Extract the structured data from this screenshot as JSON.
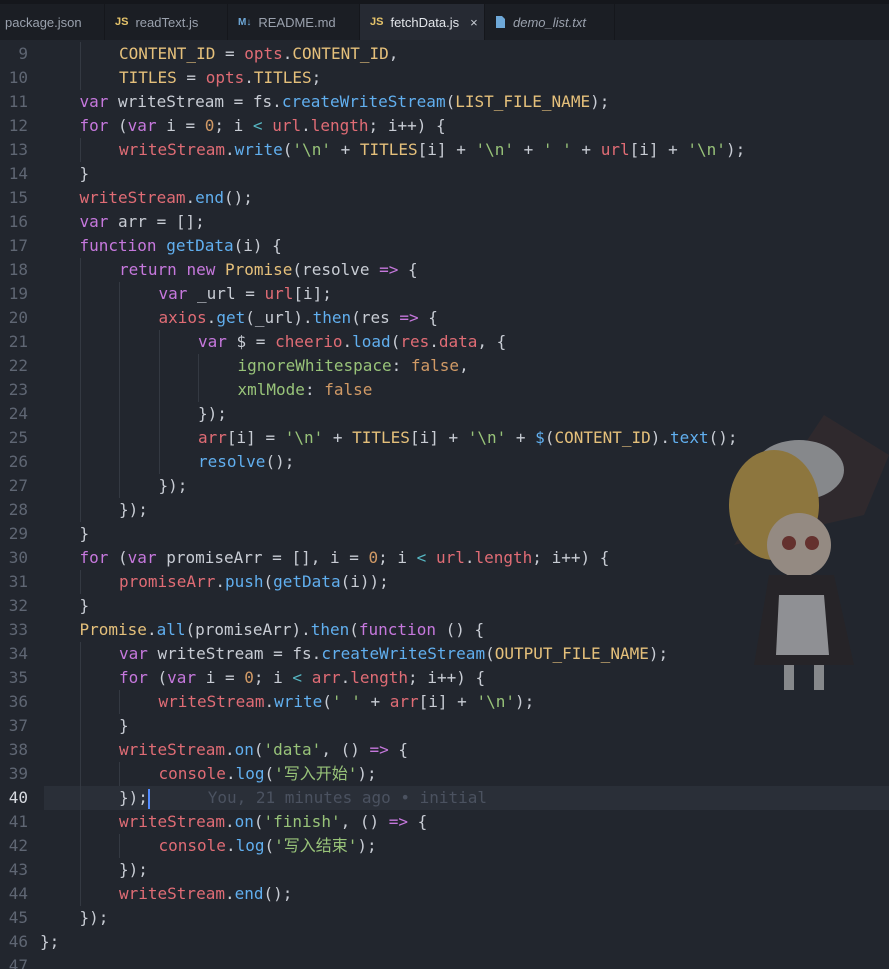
{
  "tabs": [
    {
      "label": "package.json",
      "icon": "none",
      "active": false,
      "italic": false
    },
    {
      "label": "readText.js",
      "icon": "js",
      "active": false,
      "italic": false
    },
    {
      "label": "README.md",
      "icon": "md",
      "active": false,
      "italic": false
    },
    {
      "label": "fetchData.js",
      "icon": "js",
      "active": true,
      "italic": false
    },
    {
      "label": "demo_list.txt",
      "icon": "txt",
      "active": false,
      "italic": true
    }
  ],
  "icon_labels": {
    "js": "JS",
    "md": "M↓",
    "close": "×"
  },
  "line_numbers": [
    "9",
    "10",
    "11",
    "12",
    "13",
    "14",
    "15",
    "16",
    "17",
    "18",
    "19",
    "20",
    "21",
    "22",
    "23",
    "24",
    "25",
    "26",
    "27",
    "28",
    "29",
    "30",
    "31",
    "32",
    "33",
    "34",
    "35",
    "36",
    "37",
    "38",
    "39",
    "40",
    "41",
    "42",
    "43",
    "44",
    "45",
    "46",
    "47"
  ],
  "current_line": "40",
  "blame_text": "You, 21 minutes ago • initial",
  "code_lines": [
    [
      [
        "c",
        "CONTENT_ID"
      ],
      [
        "p",
        " = "
      ],
      [
        "v",
        "opts"
      ],
      [
        "p",
        "."
      ],
      [
        "c",
        "CONTENT_ID"
      ],
      [
        "p",
        ","
      ]
    ],
    [
      [
        "c",
        "TITLES"
      ],
      [
        "p",
        " = "
      ],
      [
        "v",
        "opts"
      ],
      [
        "p",
        "."
      ],
      [
        "c",
        "TITLES"
      ],
      [
        "p",
        ";"
      ]
    ],
    [
      [
        "k",
        "var"
      ],
      [
        "t",
        " writeStream = "
      ],
      [
        "t",
        "fs"
      ],
      [
        "p",
        "."
      ],
      [
        "f",
        "createWriteStream"
      ],
      [
        "p",
        "("
      ],
      [
        "c",
        "LIST_FILE_NAME"
      ],
      [
        "p",
        ");"
      ]
    ],
    [
      [
        "k",
        "for"
      ],
      [
        "p",
        " ("
      ],
      [
        "k",
        "var"
      ],
      [
        "t",
        " i = "
      ],
      [
        "n",
        "0"
      ],
      [
        "p",
        "; i "
      ],
      [
        "o",
        "<"
      ],
      [
        "p",
        " "
      ],
      [
        "v",
        "url"
      ],
      [
        "p",
        "."
      ],
      [
        "v",
        "length"
      ],
      [
        "p",
        "; i++) {"
      ]
    ],
    [
      [
        "v",
        "writeStream"
      ],
      [
        "p",
        "."
      ],
      [
        "f",
        "write"
      ],
      [
        "p",
        "("
      ],
      [
        "s",
        "'\\n'"
      ],
      [
        "p",
        " + "
      ],
      [
        "c",
        "TITLES"
      ],
      [
        "p",
        "[i] + "
      ],
      [
        "s",
        "'\\n'"
      ],
      [
        "p",
        " + "
      ],
      [
        "s",
        "' '"
      ],
      [
        "p",
        " + "
      ],
      [
        "v",
        "url"
      ],
      [
        "p",
        "[i] + "
      ],
      [
        "s",
        "'\\n'"
      ],
      [
        "p",
        ");"
      ]
    ],
    [
      [
        "p",
        "}"
      ]
    ],
    [
      [
        "v",
        "writeStream"
      ],
      [
        "p",
        "."
      ],
      [
        "f",
        "end"
      ],
      [
        "p",
        "();"
      ]
    ],
    [
      [
        "k",
        "var"
      ],
      [
        "t",
        " arr = [];"
      ]
    ],
    [
      [
        "k",
        "function"
      ],
      [
        "p",
        " "
      ],
      [
        "f",
        "getData"
      ],
      [
        "p",
        "(i) {"
      ]
    ],
    [
      [
        "k",
        "return"
      ],
      [
        "p",
        " "
      ],
      [
        "k",
        "new"
      ],
      [
        "p",
        " "
      ],
      [
        "c",
        "Promise"
      ],
      [
        "p",
        "(resolve "
      ],
      [
        "k",
        "=>"
      ],
      [
        "p",
        " {"
      ]
    ],
    [
      [
        "k",
        "var"
      ],
      [
        "t",
        " _url = "
      ],
      [
        "v",
        "url"
      ],
      [
        "p",
        "[i];"
      ]
    ],
    [
      [
        "v",
        "axios"
      ],
      [
        "p",
        "."
      ],
      [
        "f",
        "get"
      ],
      [
        "p",
        "(_url)."
      ],
      [
        "f",
        "then"
      ],
      [
        "p",
        "(res "
      ],
      [
        "k",
        "=>"
      ],
      [
        "p",
        " {"
      ]
    ],
    [
      [
        "k",
        "var"
      ],
      [
        "t",
        " $ = "
      ],
      [
        "v",
        "cheerio"
      ],
      [
        "p",
        "."
      ],
      [
        "f",
        "load"
      ],
      [
        "p",
        "("
      ],
      [
        "v",
        "res"
      ],
      [
        "p",
        "."
      ],
      [
        "v",
        "data"
      ],
      [
        "p",
        ", {"
      ]
    ],
    [
      [
        "s",
        "ignoreWhitespace"
      ],
      [
        "p",
        ": "
      ],
      [
        "n",
        "false"
      ],
      [
        "p",
        ","
      ]
    ],
    [
      [
        "s",
        "xmlMode"
      ],
      [
        "p",
        ": "
      ],
      [
        "n",
        "false"
      ]
    ],
    [
      [
        "p",
        "});"
      ]
    ],
    [
      [
        "v",
        "arr"
      ],
      [
        "p",
        "[i] = "
      ],
      [
        "s",
        "'\\n'"
      ],
      [
        "p",
        " + "
      ],
      [
        "c",
        "TITLES"
      ],
      [
        "p",
        "[i] + "
      ],
      [
        "s",
        "'\\n'"
      ],
      [
        "p",
        " + "
      ],
      [
        "f",
        "$"
      ],
      [
        "p",
        "("
      ],
      [
        "c",
        "CONTENT_ID"
      ],
      [
        "p",
        ")."
      ],
      [
        "f",
        "text"
      ],
      [
        "p",
        "();"
      ]
    ],
    [
      [
        "f",
        "resolve"
      ],
      [
        "p",
        "();"
      ]
    ],
    [
      [
        "p",
        "});"
      ]
    ],
    [
      [
        "p",
        "});"
      ]
    ],
    [
      [
        "p",
        "}"
      ]
    ],
    [
      [
        "k",
        "for"
      ],
      [
        "p",
        " ("
      ],
      [
        "k",
        "var"
      ],
      [
        "t",
        " promiseArr = [], i = "
      ],
      [
        "n",
        "0"
      ],
      [
        "p",
        "; i "
      ],
      [
        "o",
        "<"
      ],
      [
        "p",
        " "
      ],
      [
        "v",
        "url"
      ],
      [
        "p",
        "."
      ],
      [
        "v",
        "length"
      ],
      [
        "p",
        "; i++) {"
      ]
    ],
    [
      [
        "v",
        "promiseArr"
      ],
      [
        "p",
        "."
      ],
      [
        "f",
        "push"
      ],
      [
        "p",
        "("
      ],
      [
        "f",
        "getData"
      ],
      [
        "p",
        "(i));"
      ]
    ],
    [
      [
        "p",
        "}"
      ]
    ],
    [
      [
        "c",
        "Promise"
      ],
      [
        "p",
        "."
      ],
      [
        "f",
        "all"
      ],
      [
        "p",
        "(promiseArr)."
      ],
      [
        "f",
        "then"
      ],
      [
        "p",
        "("
      ],
      [
        "k",
        "function"
      ],
      [
        "p",
        " () {"
      ]
    ],
    [
      [
        "k",
        "var"
      ],
      [
        "t",
        " writeStream = "
      ],
      [
        "t",
        "fs"
      ],
      [
        "p",
        "."
      ],
      [
        "f",
        "createWriteStream"
      ],
      [
        "p",
        "("
      ],
      [
        "c",
        "OUTPUT_FILE_NAME"
      ],
      [
        "p",
        ");"
      ]
    ],
    [
      [
        "k",
        "for"
      ],
      [
        "p",
        " ("
      ],
      [
        "k",
        "var"
      ],
      [
        "t",
        " i = "
      ],
      [
        "n",
        "0"
      ],
      [
        "p",
        "; i "
      ],
      [
        "o",
        "<"
      ],
      [
        "p",
        " "
      ],
      [
        "v",
        "arr"
      ],
      [
        "p",
        "."
      ],
      [
        "v",
        "length"
      ],
      [
        "p",
        "; i++) {"
      ]
    ],
    [
      [
        "v",
        "writeStream"
      ],
      [
        "p",
        "."
      ],
      [
        "f",
        "write"
      ],
      [
        "p",
        "("
      ],
      [
        "s",
        "' '"
      ],
      [
        "p",
        " + "
      ],
      [
        "v",
        "arr"
      ],
      [
        "p",
        "[i] + "
      ],
      [
        "s",
        "'\\n'"
      ],
      [
        "p",
        ");"
      ]
    ],
    [
      [
        "p",
        "}"
      ]
    ],
    [
      [
        "v",
        "writeStream"
      ],
      [
        "p",
        "."
      ],
      [
        "f",
        "on"
      ],
      [
        "p",
        "("
      ],
      [
        "s",
        "'data'"
      ],
      [
        "p",
        ", () "
      ],
      [
        "k",
        "=>"
      ],
      [
        "p",
        " {"
      ]
    ],
    [
      [
        "v",
        "console"
      ],
      [
        "p",
        "."
      ],
      [
        "f",
        "log"
      ],
      [
        "p",
        "("
      ],
      [
        "s",
        "'写入开始'"
      ],
      [
        "p",
        ");"
      ]
    ],
    [
      [
        "p",
        "});"
      ]
    ],
    [
      [
        "v",
        "writeStream"
      ],
      [
        "p",
        "."
      ],
      [
        "f",
        "on"
      ],
      [
        "p",
        "("
      ],
      [
        "s",
        "'finish'"
      ],
      [
        "p",
        ", () "
      ],
      [
        "k",
        "=>"
      ],
      [
        "p",
        " {"
      ]
    ],
    [
      [
        "v",
        "console"
      ],
      [
        "p",
        "."
      ],
      [
        "f",
        "log"
      ],
      [
        "p",
        "("
      ],
      [
        "s",
        "'写入结束'"
      ],
      [
        "p",
        ");"
      ]
    ],
    [
      [
        "p",
        "});"
      ]
    ],
    [
      [
        "v",
        "writeStream"
      ],
      [
        "p",
        "."
      ],
      [
        "f",
        "end"
      ],
      [
        "p",
        "();"
      ]
    ],
    [
      [
        "p",
        "});"
      ]
    ],
    [
      [
        "p",
        "};"
      ]
    ],
    []
  ]
}
